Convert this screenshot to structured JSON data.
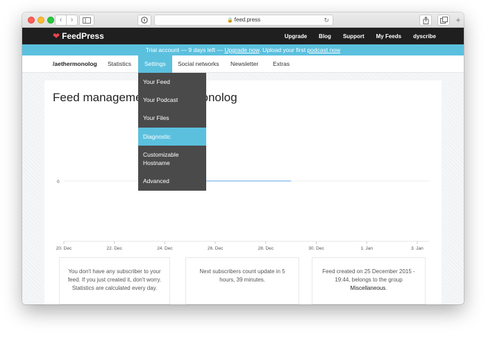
{
  "browser": {
    "url": "feed.press"
  },
  "header": {
    "logo": "FeedPress",
    "nav": [
      "Upgrade",
      "Blog",
      "Support",
      "My Feeds",
      "dyscribe"
    ]
  },
  "banner": {
    "text_pre": "Trial account — 9 days left — ",
    "upgrade_link": "Upgrade now",
    "text_mid": ". Upload your first ",
    "podcast_link": "podcast now"
  },
  "subnav": {
    "feed_name": "/aethermonolog",
    "tabs": [
      "Statistics",
      "Settings",
      "Social networks",
      "Newsletter",
      "Extras"
    ]
  },
  "settings_menu": {
    "items": [
      "Your Feed",
      "Your Podcast",
      "Your Files",
      "Diagnostic",
      "Customizable Hostname",
      "Advanced"
    ],
    "active_index": 3
  },
  "page": {
    "title": "Feed management /aethermonolog"
  },
  "chart_data": {
    "type": "line",
    "x_ticks": [
      "20. Dec",
      "22. Dec",
      "24. Dec",
      "26. Dec",
      "28. Dec",
      "30. Dec",
      "1. Jan",
      "3. Jan"
    ],
    "y_ticks": [
      "0"
    ],
    "series": [
      {
        "x": [
          "25. Dec",
          "26. Dec",
          "27. Dec",
          "28. Dec",
          "29. Dec"
        ],
        "y": [
          0,
          0,
          0,
          0,
          0
        ]
      }
    ],
    "colors": {
      "line": "#7cb5ec",
      "grid": "#e6e6e6"
    }
  },
  "stats": {
    "subscribers": "You don't have any subscriber to your feed. If you just created it, don't worry. Statistics are calculated every day.",
    "next_update": "Next subscribers count update in 5 hours, 39 minutes.",
    "created_pre": "Feed created on 25 December 2015 - 19:44, belongs to the group",
    "group": "Miscellaneous"
  },
  "colors": {
    "accent": "#5bc0de",
    "header_bg": "#1f1f1f",
    "dropdown_bg": "#4a4a4a"
  }
}
